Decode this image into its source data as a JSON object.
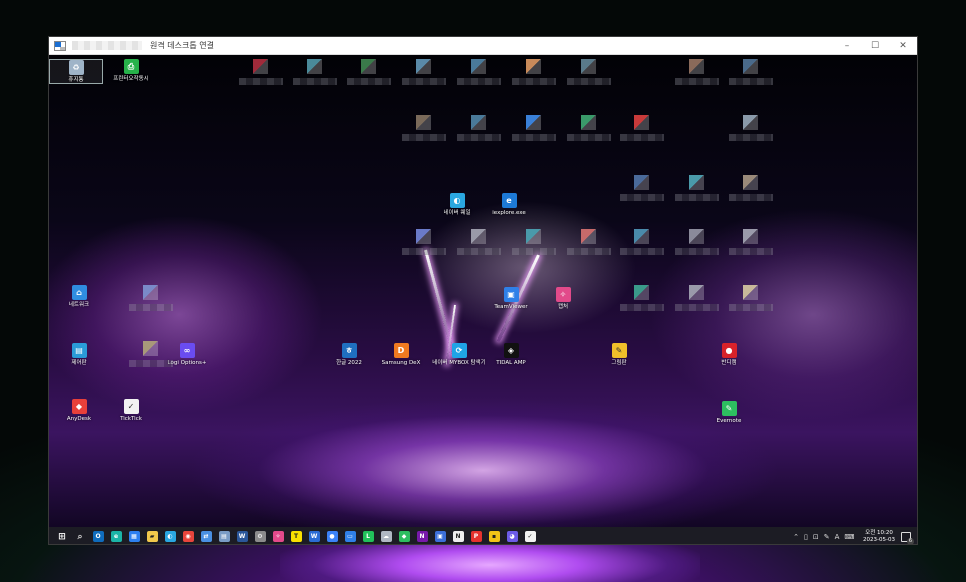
{
  "window": {
    "title": "원격 데스크톱 연결",
    "controls": {
      "minimize": "–",
      "maximize": "☐",
      "close": "✕"
    }
  },
  "desktop_icons": [
    {
      "label": "휴지통",
      "icon": "recycle-bin-icon",
      "color": "#9fb4c8",
      "selected": true
    },
    {
      "label": "프린터오작동시",
      "icon": "printer-icon",
      "color": "#27b24a"
    },
    {
      "label": "네이버 웨일",
      "icon": "whale-browser-icon",
      "color": "#2aa7e0"
    },
    {
      "label": "iexplore.exe",
      "icon": "internet-explorer-icon",
      "color": "#1d7ad6"
    },
    {
      "label": "네트워크",
      "icon": "network-icon",
      "color": "#2f8de0"
    },
    {
      "label": "Logi Options+",
      "icon": "logi-options-icon",
      "color": "#6a4cf0"
    },
    {
      "label": "제어판",
      "icon": "control-panel-icon",
      "color": "#2a9bd8"
    },
    {
      "label": "AnyDesk",
      "icon": "anydesk-icon",
      "color": "#e8403a"
    },
    {
      "label": "TickTick",
      "icon": "ticktick-icon",
      "color": "#f2f2f2"
    },
    {
      "label": "한글 2022",
      "icon": "hangul-icon",
      "color": "#1f6fc0"
    },
    {
      "label": "Samsung DeX",
      "icon": "samsung-dex-icon",
      "color": "#f07a20"
    },
    {
      "label": "네이버 MYBOX 탐색기",
      "icon": "mybox-icon",
      "color": "#1fa4e6"
    },
    {
      "label": "TIDAL AMP",
      "icon": "tidal-icon",
      "color": "#111111"
    },
    {
      "label": "TeamViewer",
      "icon": "remote-desktop-icon",
      "color": "#2f80e8"
    },
    {
      "label": "캡처",
      "icon": "palette-icon",
      "color": "#e24a8a"
    },
    {
      "label": "그림판",
      "icon": "paint-icon",
      "color": "#f0c02a"
    },
    {
      "label": "반디캠",
      "icon": "bandicam-icon",
      "color": "#d8222a"
    },
    {
      "label": "Evernote",
      "icon": "evernote-icon",
      "color": "#2dbe60"
    }
  ],
  "taskbar": {
    "apps": [
      {
        "icon": "windows-start-icon",
        "color": "#ffffff"
      },
      {
        "icon": "search-icon",
        "color": "#cfcfcf"
      },
      {
        "icon": "outlook-icon",
        "color": "#0f6cbd"
      },
      {
        "icon": "edge-icon",
        "color": "#1bb4a7"
      },
      {
        "icon": "calendar-icon",
        "color": "#2d7ff0"
      },
      {
        "icon": "file-explorer-icon",
        "color": "#f2c94c"
      },
      {
        "icon": "whale-browser-icon",
        "color": "#2aa7e0"
      },
      {
        "icon": "chrome-icon",
        "color": "#e8453c"
      },
      {
        "icon": "remote-icon",
        "color": "#4a90e2"
      },
      {
        "icon": "notes-icon",
        "color": "#7a9cc6"
      },
      {
        "icon": "word-icon",
        "color": "#2b579a"
      },
      {
        "icon": "settings-icon",
        "color": "#8c8c8c"
      },
      {
        "icon": "palette-icon",
        "color": "#e24a8a"
      },
      {
        "icon": "kakaotalk-icon",
        "color": "#f9e000"
      },
      {
        "icon": "word-doc-icon",
        "color": "#2b6cd4"
      },
      {
        "icon": "teams-icon",
        "color": "#3b82f6"
      },
      {
        "icon": "monitor-icon",
        "color": "#2f80e8"
      },
      {
        "icon": "line-icon",
        "color": "#21c15a"
      },
      {
        "icon": "cloud-icon",
        "color": "#b0b8c4"
      },
      {
        "icon": "evernote-icon",
        "color": "#2dbe60"
      },
      {
        "icon": "onenote-icon",
        "color": "#7719aa"
      },
      {
        "icon": "chat-icon",
        "color": "#3c6fd8"
      },
      {
        "icon": "notion-icon",
        "color": "#eeeeee"
      },
      {
        "icon": "pdf-icon",
        "color": "#e5322d"
      },
      {
        "icon": "sticky-notes-icon",
        "color": "#f2c417"
      },
      {
        "icon": "discord-icon",
        "color": "#6c5ce7"
      },
      {
        "icon": "ticktick-icon",
        "color": "#f2f2f2"
      }
    ],
    "tray": {
      "ime": "A",
      "clock_time": "오전 10:20",
      "clock_date": "2023-05-03",
      "notification_count": "6"
    }
  }
}
